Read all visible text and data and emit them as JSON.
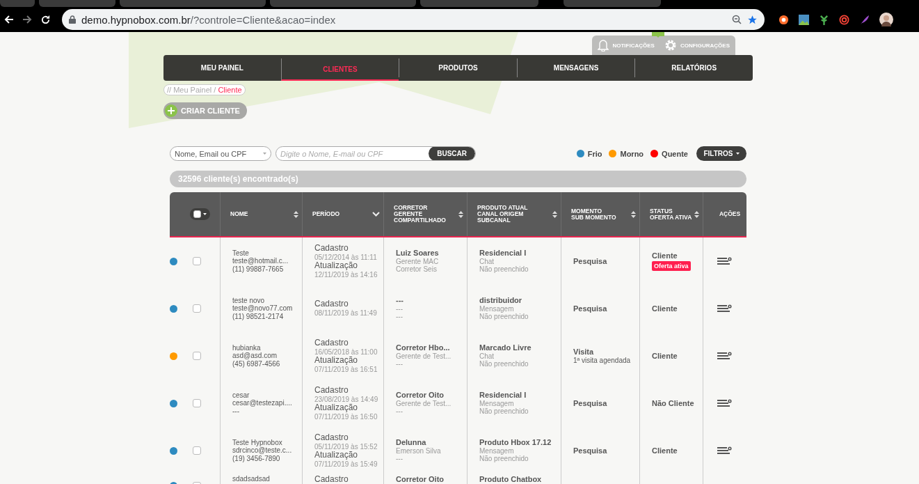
{
  "browser": {
    "url_host": "demo.hypnobox.com.br",
    "url_path": "/?controle=Cliente&acao=index"
  },
  "header": {
    "notifications": "NOTIFICAÇÕES",
    "settings": "CONFIGURAÇÕES"
  },
  "nav": [
    {
      "label": "MEU PAINEL",
      "selected": false
    },
    {
      "label": "CLIENTES",
      "selected": true
    },
    {
      "label": "PRODUTOS",
      "selected": false
    },
    {
      "label": "MENSAGENS",
      "selected": false
    },
    {
      "label": "RELATÓRIOS",
      "selected": false
    }
  ],
  "breadcrumb": {
    "path": "// Meu Painel /",
    "current": "Cliente"
  },
  "create_button": "CRIAR CLIENTE",
  "search": {
    "type_select": "Nome, Email ou CPF",
    "placeholder": "Digite o Nome, E-mail ou CPF",
    "button": "BUSCAR"
  },
  "legend": [
    {
      "label": "Frio",
      "color": "#2e8bc0"
    },
    {
      "label": "Morno",
      "color": "#ff9a00"
    },
    {
      "label": "Quente",
      "color": "#ff0000"
    }
  ],
  "filters_button": "FILTROS",
  "result_count": "32596 cliente(s) encontrado(s)",
  "table": {
    "columns": [
      {
        "kind": "select_all"
      },
      {
        "lines": [
          "NOME"
        ],
        "sortable": true,
        "sorted": false
      },
      {
        "lines": [
          "PERÍODO"
        ],
        "sortable": true,
        "sorted": true
      },
      {
        "lines": [
          "CORRETOR",
          "GERENTE",
          "COMPARTILHADO"
        ],
        "sortable": true,
        "sorted": false
      },
      {
        "lines": [
          "PRODUTO ATUAL",
          "CANAL ORIGEM",
          "SUBCANAL"
        ],
        "sortable": true,
        "sorted": false
      },
      {
        "lines": [
          "MOMENTO",
          "SUB MOMENTO"
        ],
        "sortable": true,
        "sorted": false
      },
      {
        "lines": [
          "STATUS",
          "OFERTA ATIVA"
        ],
        "sortable": true,
        "sorted": false
      },
      {
        "lines": [
          "AÇÕES"
        ],
        "sortable": false,
        "sorted": false
      }
    ],
    "rows": [
      {
        "color": "#2e8bc0",
        "checked": false,
        "nome": [
          "Teste",
          "teste@hotmail.c...",
          "(11) 99887-7665"
        ],
        "periodo": [
          {
            "label": "Cadastro",
            "date": "05/12/2014 às 11:11"
          },
          {
            "label": "Atualização",
            "date": "12/11/2019 às 14:16"
          }
        ],
        "corretor": [
          "Luiz Soares",
          "Gerente MAC",
          "Corretor Seis"
        ],
        "produto": [
          "Residencial I",
          "Chat",
          "Não preenchido"
        ],
        "momento": [
          "Pesquisa"
        ],
        "status": "Cliente",
        "offer": "Oferta ativa"
      },
      {
        "color": "#2e8bc0",
        "checked": false,
        "nome": [
          "teste novo",
          "teste@novo77.com",
          "(11) 98521-2174"
        ],
        "periodo": [
          {
            "label": "Cadastro",
            "date": "08/11/2019 às 11:49"
          }
        ],
        "corretor": [
          "---",
          "---",
          "---"
        ],
        "produto": [
          "distribuidor",
          "Mensagem",
          "Não preenchido"
        ],
        "momento": [
          "Pesquisa"
        ],
        "status": "Cliente"
      },
      {
        "color": "#ff9a00",
        "checked": false,
        "nome": [
          "hubianka",
          "asd@asd.com",
          "(45) 6987-4566"
        ],
        "periodo": [
          {
            "label": "Cadastro",
            "date": "16/05/2018 às 11:00"
          },
          {
            "label": "Atualização",
            "date": "07/11/2019 às 16:51"
          }
        ],
        "corretor": [
          "Corretor Hbo...",
          "Gerente de Test...",
          "---"
        ],
        "produto": [
          "Marcado Livre",
          "Chat",
          "Não preenchido"
        ],
        "momento": [
          "Visita",
          "1ª visita agendada"
        ],
        "status": "Cliente"
      },
      {
        "color": "#2e8bc0",
        "checked": false,
        "nome": [
          "cesar",
          "cesar@testezapi....",
          "---"
        ],
        "periodo": [
          {
            "label": "Cadastro",
            "date": "23/08/2019 às 14:49"
          },
          {
            "label": "Atualização",
            "date": "07/11/2019 às 16:50"
          }
        ],
        "corretor": [
          "Corretor Oito",
          "Gerente de Test...",
          "---"
        ],
        "produto": [
          "Residencial I",
          "Mensagem",
          "Não preenchido"
        ],
        "momento": [
          "Pesquisa"
        ],
        "status": "Não Cliente"
      },
      {
        "color": "#2e8bc0",
        "checked": false,
        "nome": [
          "Teste Hypnobox",
          "sdrcinco@teste.c...",
          "(19) 3456-7890"
        ],
        "periodo": [
          {
            "label": "Cadastro",
            "date": "05/11/2019 às 15:52"
          },
          {
            "label": "Atualização",
            "date": "07/11/2019 às 15:49"
          }
        ],
        "corretor": [
          "Delunna",
          "Emerson Silva",
          "---"
        ],
        "produto": [
          "Produto Hbox 17.12",
          "Mensagem",
          "Não preenchido"
        ],
        "momento": [
          "Pesquisa"
        ],
        "status": "Cliente"
      },
      {
        "color": "#2e8bc0",
        "checked": false,
        "nome": [
          "sdadsadsad"
        ],
        "periodo": [
          {
            "label": "Cadastro"
          }
        ],
        "corretor": [
          "Corretor Oito"
        ],
        "produto": [
          "Produto Chatbox"
        ],
        "momento": []
      }
    ]
  }
}
